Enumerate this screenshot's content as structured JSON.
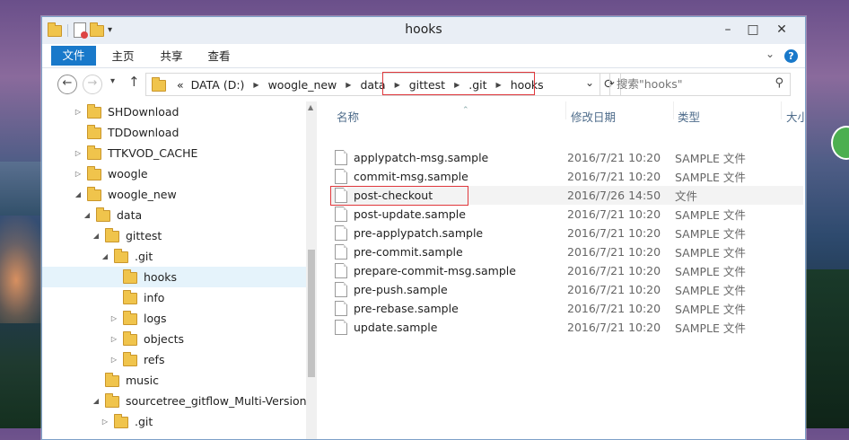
{
  "window": {
    "title": "hooks",
    "controls": {
      "minimize": "–",
      "maximize": "□",
      "close": "✕"
    }
  },
  "ribbon": {
    "file_tab": "文件",
    "tabs": [
      "主页",
      "共享",
      "查看"
    ],
    "help": "?"
  },
  "address": {
    "path": [
      "DATA (D:)",
      "woogle_new",
      "data",
      "gittest",
      ".git",
      "hooks"
    ],
    "prefix": "«"
  },
  "search": {
    "placeholder": "搜索\"hooks\""
  },
  "nav_tree": [
    {
      "label": "SHDownload",
      "expander": "▷"
    },
    {
      "label": "TDDownload",
      "expander": ""
    },
    {
      "label": "TTKVOD_CACHE",
      "expander": "▷"
    },
    {
      "label": "woogle",
      "expander": "▷"
    },
    {
      "label": "woogle_new",
      "expander": "◢"
    },
    {
      "label": "data",
      "expander": "◢"
    },
    {
      "label": "gittest",
      "expander": "◢"
    },
    {
      "label": ".git",
      "expander": "◢"
    },
    {
      "label": "hooks",
      "expander": "",
      "selected": true
    },
    {
      "label": "info",
      "expander": ""
    },
    {
      "label": "logs",
      "expander": "▷"
    },
    {
      "label": "objects",
      "expander": "▷"
    },
    {
      "label": "refs",
      "expander": "▷"
    },
    {
      "label": "music",
      "expander": ""
    },
    {
      "label": "sourcetree_gitflow_Multi-Version-C",
      "expander": "◢"
    },
    {
      "label": ".git",
      "expander": "▷"
    }
  ],
  "columns": {
    "name": "名称",
    "date": "修改日期",
    "type": "类型",
    "size": "大小"
  },
  "files": [
    {
      "name": "applypatch-msg.sample",
      "date": "2016/7/21 10:20",
      "type": "SAMPLE 文件"
    },
    {
      "name": "commit-msg.sample",
      "date": "2016/7/21 10:20",
      "type": "SAMPLE 文件"
    },
    {
      "name": "post-checkout",
      "date": "2016/7/26 14:50",
      "type": "文件"
    },
    {
      "name": "post-update.sample",
      "date": "2016/7/21 10:20",
      "type": "SAMPLE 文件"
    },
    {
      "name": "pre-applypatch.sample",
      "date": "2016/7/21 10:20",
      "type": "SAMPLE 文件"
    },
    {
      "name": "pre-commit.sample",
      "date": "2016/7/21 10:20",
      "type": "SAMPLE 文件"
    },
    {
      "name": "prepare-commit-msg.sample",
      "date": "2016/7/21 10:20",
      "type": "SAMPLE 文件"
    },
    {
      "name": "pre-push.sample",
      "date": "2016/7/21 10:20",
      "type": "SAMPLE 文件"
    },
    {
      "name": "pre-rebase.sample",
      "date": "2016/7/21 10:20",
      "type": "SAMPLE 文件"
    },
    {
      "name": "update.sample",
      "date": "2016/7/21 10:20",
      "type": "SAMPLE 文件"
    }
  ],
  "icons": {
    "back": "back-arrow-icon",
    "forward": "forward-arrow-icon",
    "up": "up-arrow-icon",
    "refresh": "refresh-icon",
    "search": "magnifier-icon",
    "help": "help-icon"
  },
  "colors": {
    "accent": "#1979ca",
    "highlight_box": "#e0383c",
    "selection": "#e5f3fb"
  }
}
